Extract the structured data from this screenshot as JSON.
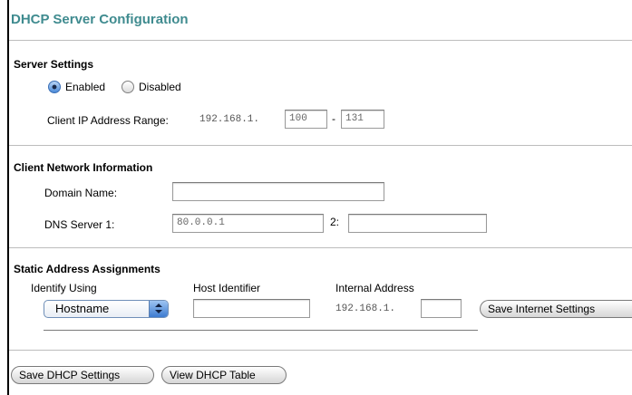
{
  "page": {
    "title": "DHCP Server Configuration"
  },
  "server_settings": {
    "heading": "Server Settings",
    "enabled_label": "Enabled",
    "disabled_label": "Disabled",
    "selected": "Enabled",
    "range_label": "Client IP Address Range:",
    "range_prefix": "192.168.1.",
    "range_start": "100",
    "range_dash": "-",
    "range_end": "131"
  },
  "client_network": {
    "heading": "Client Network Information",
    "domain_label": "Domain Name:",
    "domain_value": "",
    "dns1_label": "DNS Server 1:",
    "dns1_value": "80.0.0.1",
    "dns2_label": "2:",
    "dns2_value": ""
  },
  "static_assignments": {
    "heading": "Static Address Assignments",
    "identify_label": "Identify Using",
    "identify_value": "Hostname",
    "host_label": "Host Identifier",
    "host_value": "",
    "internal_label": "Internal Address",
    "internal_prefix": "192.168.1.",
    "internal_value": "",
    "save_internet_button": "Save Internet Settings"
  },
  "footer": {
    "save_dhcp_button": "Save DHCP Settings",
    "view_table_button": "View DHCP Table"
  },
  "colors": {
    "title": "#3f8b8f",
    "radio_selected": "#4b8ad8",
    "divider": "#bdbdbd"
  }
}
